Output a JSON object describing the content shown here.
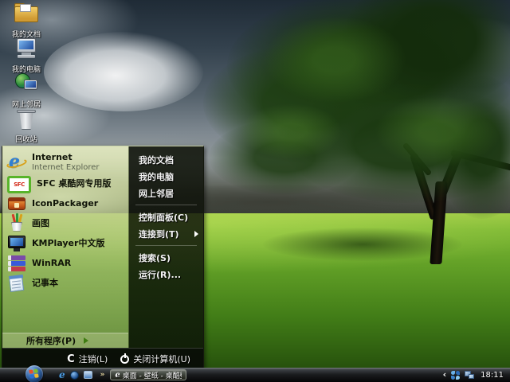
{
  "desktop": {
    "icons": [
      {
        "label": "我的文档",
        "icon": "my-documents-icon"
      },
      {
        "label": "我的电脑",
        "icon": "my-computer-icon"
      },
      {
        "label": "网上邻居",
        "icon": "network-places-icon"
      },
      {
        "label": "回收站",
        "icon": "recycle-bin-icon"
      }
    ]
  },
  "start_menu": {
    "left_items": [
      {
        "label": "Internet",
        "sublabel": "Internet Explorer",
        "icon": "internet-explorer-icon"
      },
      {
        "label": "SFC 桌酷网专用版",
        "icon": "sfc-icon"
      },
      {
        "label": "IconPackager",
        "icon": "iconpackager-icon"
      },
      {
        "label": "画图",
        "icon": "paint-icon"
      },
      {
        "label": "KMPlayer中文版",
        "icon": "kmplayer-icon"
      },
      {
        "label": "WinRAR",
        "icon": "winrar-icon"
      },
      {
        "label": "记事本",
        "icon": "notepad-icon"
      }
    ],
    "all_programs_label": "所有程序(P)",
    "right_main": [
      "我的文档",
      "我的电脑",
      "网上邻居"
    ],
    "right_system": [
      "控制面板(C)",
      "连接到(T)"
    ],
    "right_search": [
      "搜索(S)",
      "运行(R)..."
    ],
    "logoff_label": "注销(L)",
    "shutdown_label": "关闭计算机(U)"
  },
  "taskbar": {
    "start_icon": "windows-orb-icon",
    "quick_launch": [
      "ie-quick-launch-icon",
      "globe-quick-launch-icon",
      "window-quick-launch-icon"
    ],
    "overflow_chevron": "»",
    "task_button_label": "桌面 - 壁纸 - 桌酷壁...",
    "tray_collapse_chevron": "‹",
    "tray_icons": [
      "pinwheel-tray-icon",
      "network-tray-icon"
    ],
    "clock": "18:11"
  },
  "colors": {
    "menu_left_panel": "#c8d49c",
    "menu_right_panel": "#10140a",
    "taskbar_bg": "#1a1c1e",
    "grass_green": "#619f26",
    "sky_slate": "#33414d",
    "accent_green": "#7dbb2f"
  }
}
